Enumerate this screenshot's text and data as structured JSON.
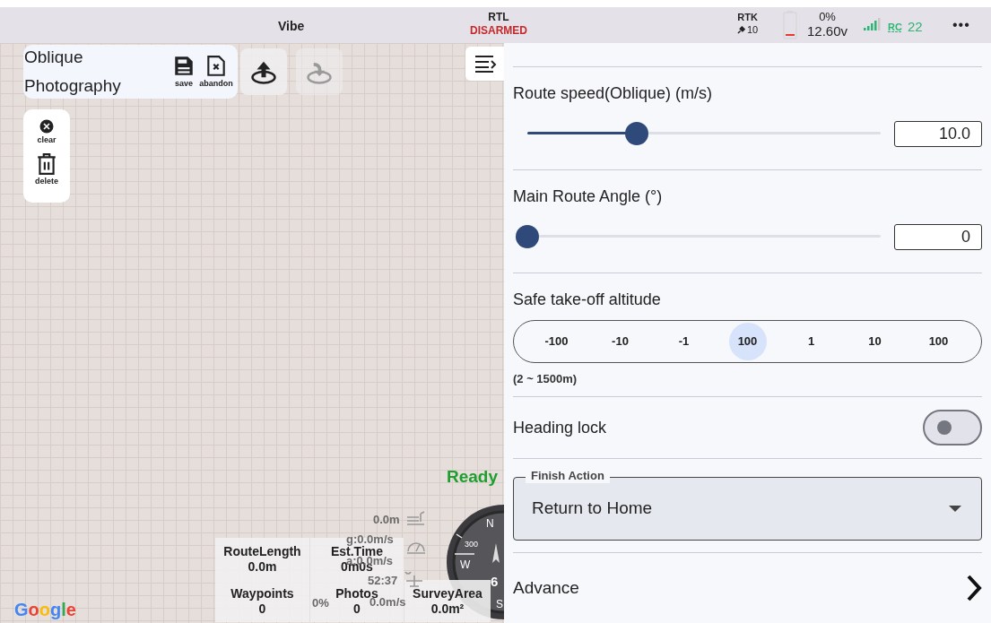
{
  "top_bar": {
    "title": "Vibe",
    "mode": "RTL",
    "arm_state": "DISARMED",
    "gps_label": "RTK",
    "satellites": "10",
    "battery_percent": "0%",
    "voltage": "12.60v",
    "rc_label": "RC",
    "rc_value": "22",
    "more": "•••"
  },
  "mission_card": {
    "title": "Oblique Photography",
    "actions": [
      {
        "kind": "save",
        "label": "save"
      },
      {
        "kind": "abandon",
        "label": "abandon"
      }
    ]
  },
  "map_buttons": [
    {
      "kind": "upload",
      "disabled": false
    },
    {
      "kind": "download",
      "disabled": true
    }
  ],
  "map_tools": [
    {
      "kind": "clear",
      "label": "clear"
    },
    {
      "kind": "delete",
      "label": "delete"
    }
  ],
  "status": "Ready",
  "telemetry": {
    "altitude": "0.0m",
    "ground_speed": "g:0.0m/s",
    "air_speed": "a:0.0m/s",
    "time": "52:37",
    "throttle": "0%",
    "vertical_speed": "0.0m/s"
  },
  "compass": {
    "north": "N",
    "west": "W",
    "south": "S",
    "heading_mark": "300",
    "satellites": "6"
  },
  "stats": [
    [
      {
        "label": "RouteLength",
        "value": "0.0m"
      },
      {
        "label": "Est.Time",
        "value": "0m0s"
      }
    ],
    [
      {
        "label": "Waypoints",
        "value": "0"
      },
      {
        "label": "Photos",
        "value": "0"
      },
      {
        "label": "SurveyArea",
        "value": "0.0m²"
      }
    ]
  ],
  "map_attribution": "Google",
  "panel": {
    "sliders": [
      {
        "label": "Route speed(Oblique) (m/s)",
        "level": 0.31,
        "value": "10.0"
      },
      {
        "label": "Main Route Angle (°)",
        "level": 0,
        "value": "0"
      }
    ],
    "altitude": {
      "label": "Safe take-off altitude",
      "steps": [
        {
          "label": "-100",
          "selected": false
        },
        {
          "label": "-10",
          "selected": false
        },
        {
          "label": "-1",
          "selected": false
        },
        {
          "label": "100",
          "selected": true
        },
        {
          "label": "1",
          "selected": false
        },
        {
          "label": "10",
          "selected": false
        },
        {
          "label": "100",
          "selected": false
        }
      ],
      "range": "(2 ~ 1500m)"
    },
    "heading_lock": {
      "label": "Heading lock",
      "on": false
    },
    "finish_action": {
      "legend": "Finish Action",
      "value": "Return to Home"
    },
    "advance": {
      "label": "Advance"
    }
  }
}
